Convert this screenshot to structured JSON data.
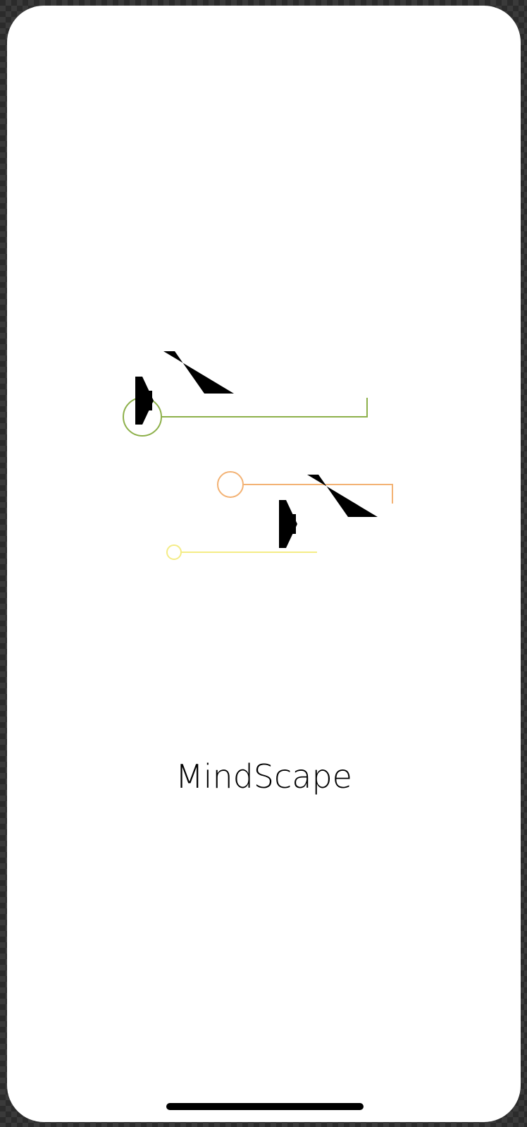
{
  "app": {
    "name": "MindScape"
  },
  "icons": {
    "plane_top": "airplane-icon",
    "plane_bottom": "airplane-icon"
  },
  "colors": {
    "background": "#ffffff",
    "frame": "#2b2b2b",
    "plane": "#000000",
    "text": "#000000",
    "route_green": "#8db04a",
    "route_orange": "#f3b274",
    "route_yellow": "#f4ec86"
  }
}
